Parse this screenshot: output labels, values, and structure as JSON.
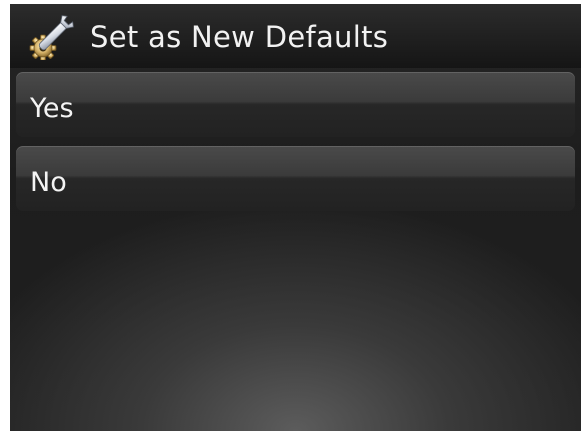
{
  "header": {
    "title": "Set as New Defaults",
    "icon": "wrench-gear-icon"
  },
  "menu": {
    "items": [
      {
        "label": "Yes"
      },
      {
        "label": "No"
      }
    ]
  },
  "colors": {
    "background": "#1f1f1f",
    "text": "#f2f2f2",
    "button": "#333333"
  }
}
